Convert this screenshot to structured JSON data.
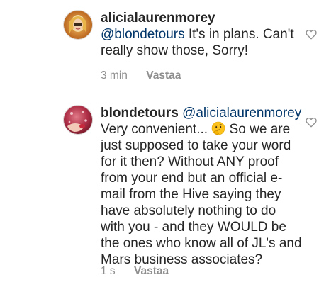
{
  "comments": [
    {
      "username": "alicialaurenmorey",
      "mention": "@blondetours",
      "text": "It's in plans. Can't really show those, Sorry!",
      "time": "3 min",
      "reply_label": "Vastaa",
      "like_icon": "heart-outline-icon"
    },
    {
      "username": "blondetours",
      "mention": "@alicialaurenmorey",
      "text_before_emoji": "Very convenient...",
      "emoji": "thinking-face-emoji",
      "text_after_emoji": "So we are just supposed to take your word for it then? Without ANY proof from your end but an official e-mail from the Hive saying they have absolutely nothing to do with you - and they WOULD be the ones who know all of JL's and Mars business associates?",
      "time": "1 s",
      "reply_label": "Vastaa",
      "like_icon": "heart-outline-icon"
    }
  ],
  "colors": {
    "text": "#262626",
    "mention": "#003569",
    "meta": "#8e8e8e",
    "heart_stroke": "#8e8e8e"
  }
}
